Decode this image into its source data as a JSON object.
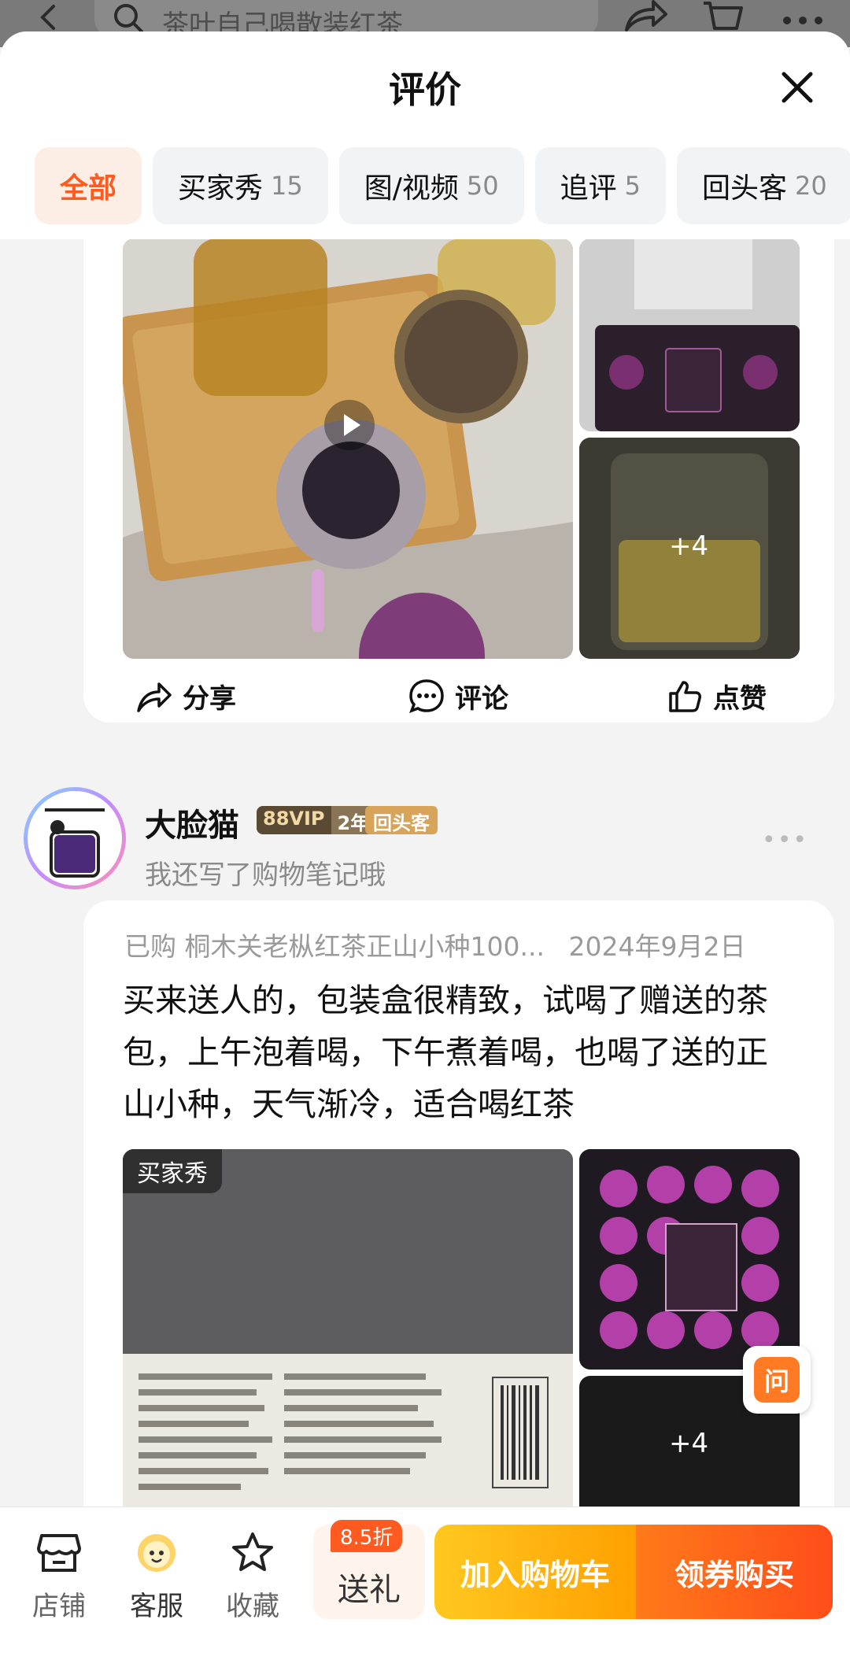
{
  "top_bar": {
    "search_placeholder": "茶叶自己喝散装红茶"
  },
  "sheet": {
    "title": "评价",
    "tabs": [
      {
        "label": "全部",
        "count": ""
      },
      {
        "label": "买家秀",
        "count": "15"
      },
      {
        "label": "图/视频",
        "count": "50"
      },
      {
        "label": "追评",
        "count": "5"
      },
      {
        "label": "回头客",
        "count": "20"
      }
    ]
  },
  "review1": {
    "more_images": "+4",
    "actions": {
      "share": "分享",
      "comment": "评论",
      "like": "点赞"
    }
  },
  "review2": {
    "username": "大脸猫",
    "vip_level": "88VIP",
    "vip_years": "2年",
    "returning_badge": "回头客",
    "subtitle": "我还写了购物笔记哦",
    "purchase_label": "已购",
    "product": "桐木关老枞红茶正山小种100...",
    "date": "2024年9月2日",
    "text": "买来送人的，包装盒很精致，试喝了赠送的茶包，上午泡着喝，下午煮着喝，也喝了送的正山小种，天气渐冷，适合喝红茶",
    "image_tag": "买家秀",
    "more_images": "+4",
    "ask_label": "问"
  },
  "bottom_bar": {
    "store": "店铺",
    "service": "客服",
    "favorite": "收藏",
    "gift_discount": "8.5折",
    "gift": "送礼",
    "add_to_cart": "加入购物车",
    "buy_with_coupon": "领券购买"
  },
  "colors": {
    "accent": "#ff5a1f",
    "cart": "#ffb300",
    "buy": "#ff5a1f"
  }
}
